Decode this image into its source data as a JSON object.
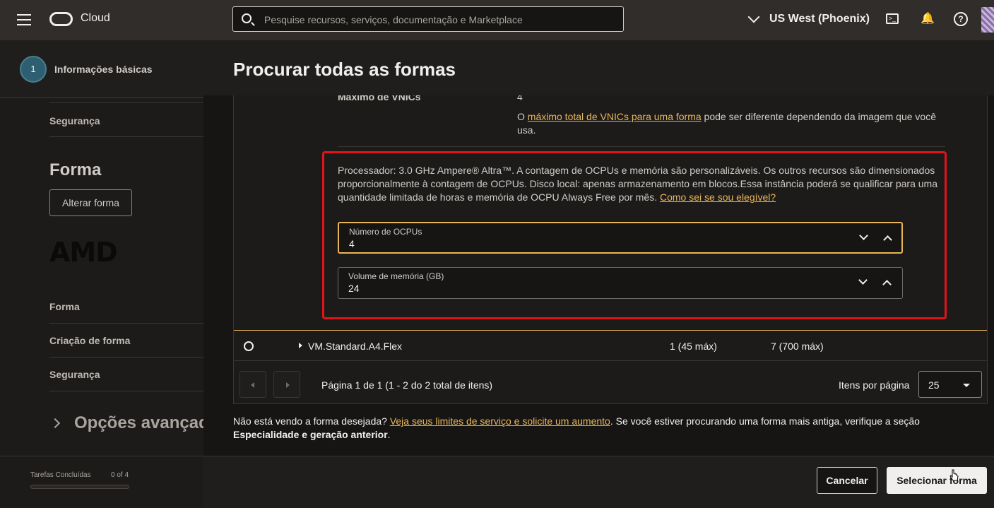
{
  "topbar": {
    "brand": "Cloud",
    "search_placeholder": "Pesquise recursos, serviços, documentação e Marketplace",
    "region": "US West (Phoenix)"
  },
  "left": {
    "step_number": "1",
    "step_label": "Informações básicas",
    "security_top": "Segurança",
    "section_title": "Forma",
    "change_shape": "Alterar forma",
    "vendor_logo": "AMD",
    "links": [
      "Forma",
      "Criação de forma",
      "Segurança"
    ],
    "advanced": "Opções avançadas",
    "tasks_label": "Tarefas Concluídas",
    "tasks_count": "0 of 4",
    "tasks_progress": 0
  },
  "panel": {
    "title": "Procurar todas as formas",
    "vnic_label": "Máximo de VNICs",
    "vnic_value": "4",
    "vnic_note_pre": "O ",
    "vnic_note_link": "máximo total de VNICs para uma forma",
    "vnic_note_post": " pode ser diferente dependendo da imagem que você usa.",
    "processor_text": "Processador: 3.0 GHz Ampere® Altra™. A contagem de OCPUs e memória são personalizáveis. Os outros recursos são dimensionados proporcionalmente à contagem de OCPUs. Disco local: apenas armazenamento em blocos.Essa instância poderá se qualificar para uma quantidade limitada de horas e memória de OCPU Always Free por mês. ",
    "eligible_link": "Como sei se sou elegível?",
    "ocpu_label": "Número de OCPUs",
    "ocpu_value": "4",
    "memory_label": "Volume de memória (GB)",
    "memory_value": "24",
    "row": {
      "name": "VM.Standard.A4.Flex",
      "ocpu": "1 (45 máx)",
      "memory": "7 (700 máx)"
    },
    "pagination": {
      "info": "Página 1 de 1 (1 - 2 do 2 total de itens)",
      "per_page_label": "Itens por página",
      "per_page_value": "25"
    },
    "footnote_pre": "Não está vendo a forma desejada? ",
    "footnote_link": "Veja seus limites de serviço e solicite um aumento",
    "footnote_mid": ". Se você estiver procurando uma forma mais antiga, verifique a seção ",
    "footnote_bold": "Especialidade e geração anterior",
    "footnote_end": ".",
    "cancel": "Cancelar",
    "select": "Selecionar forma"
  },
  "colors": {
    "accent": "#e8b65a",
    "highlight": "#e2131b",
    "topbar": "#312d2a"
  }
}
